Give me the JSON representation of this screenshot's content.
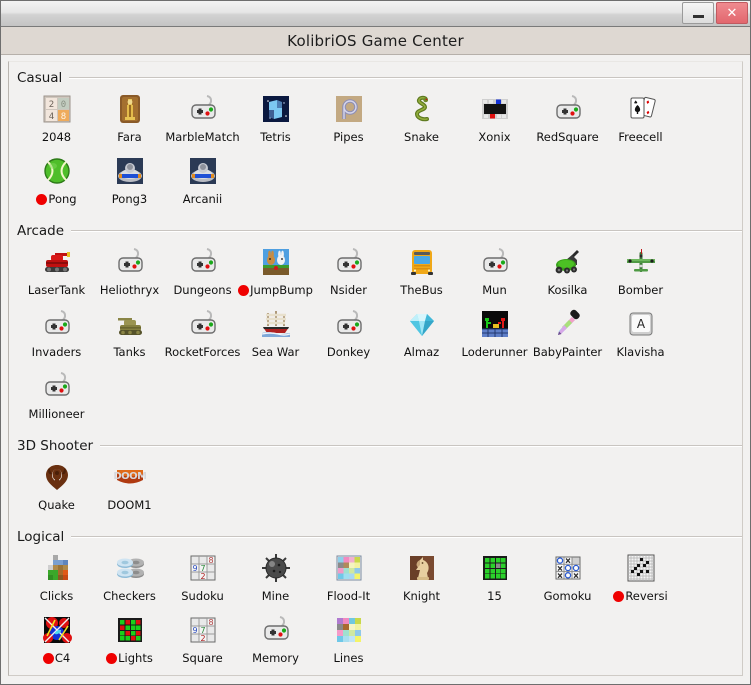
{
  "window": {
    "title": "KolibriOS Game Center",
    "minimize_label": "–",
    "close_label": "✕",
    "accent_red": "#ef0000",
    "close_button_color": "#e2676e",
    "caption_bg": "#ded8d2",
    "content_bg": "#f2f1f0"
  },
  "sections": [
    {
      "title": "Casual",
      "items": [
        {
          "label": "2048",
          "icon": "2048-icon",
          "flagged": false
        },
        {
          "label": "Fara",
          "icon": "fara-icon",
          "flagged": false
        },
        {
          "label": "MarbleMatch",
          "icon": "gamepad-icon",
          "flagged": false
        },
        {
          "label": "Tetris",
          "icon": "tetris-icon",
          "flagged": false
        },
        {
          "label": "Pipes",
          "icon": "pipes-icon",
          "flagged": false
        },
        {
          "label": "Snake",
          "icon": "snake-icon",
          "flagged": false
        },
        {
          "label": "Xonix",
          "icon": "xonix-icon",
          "flagged": false
        },
        {
          "label": "RedSquare",
          "icon": "gamepad-icon",
          "flagged": false
        },
        {
          "label": "Freecell",
          "icon": "cards-icon",
          "flagged": false
        },
        {
          "label": "Pong",
          "icon": "tennisball-icon",
          "flagged": true
        },
        {
          "label": "Pong3",
          "icon": "pong3-icon",
          "flagged": false
        },
        {
          "label": "Arcanii",
          "icon": "pong3-icon",
          "flagged": false
        }
      ]
    },
    {
      "title": "Arcade",
      "items": [
        {
          "label": "LaserTank",
          "icon": "redtank-icon",
          "flagged": false
        },
        {
          "label": "Heliothryx",
          "icon": "gamepad-icon",
          "flagged": false
        },
        {
          "label": "Dungeons",
          "icon": "gamepad-icon",
          "flagged": false
        },
        {
          "label": "JumpBump",
          "icon": "jumpbump-icon",
          "flagged": true
        },
        {
          "label": "Nsider",
          "icon": "gamepad-icon",
          "flagged": false
        },
        {
          "label": "TheBus",
          "icon": "bus-icon",
          "flagged": false
        },
        {
          "label": "Mun",
          "icon": "gamepad-icon",
          "flagged": false
        },
        {
          "label": "Kosilka",
          "icon": "mower-icon",
          "flagged": false
        },
        {
          "label": "Bomber",
          "icon": "plane-icon",
          "flagged": false
        },
        {
          "label": "Invaders",
          "icon": "gamepad-icon",
          "flagged": false
        },
        {
          "label": "Tanks",
          "icon": "khakitank-icon",
          "flagged": false
        },
        {
          "label": "RocketForces",
          "icon": "gamepad-icon",
          "flagged": false
        },
        {
          "label": "Sea War",
          "icon": "ship-icon",
          "flagged": false
        },
        {
          "label": "Donkey",
          "icon": "gamepad-icon",
          "flagged": false
        },
        {
          "label": "Almaz",
          "icon": "diamond-icon",
          "flagged": false
        },
        {
          "label": "Loderunner",
          "icon": "loderunner-icon",
          "flagged": false
        },
        {
          "label": "BabyPainter",
          "icon": "dropper-icon",
          "flagged": false
        },
        {
          "label": "Klavisha",
          "icon": "keycap-a-icon",
          "flagged": false
        },
        {
          "label": "Millioneer",
          "icon": "gamepad-icon",
          "flagged": false
        }
      ]
    },
    {
      "title": "3D Shooter",
      "items": [
        {
          "label": "Quake",
          "icon": "quake-icon",
          "flagged": false
        },
        {
          "label": "DOOM1",
          "icon": "doom-icon",
          "flagged": false
        }
      ]
    },
    {
      "title": "Logical",
      "items": [
        {
          "label": "Clicks",
          "icon": "clicks-icon",
          "flagged": false
        },
        {
          "label": "Checkers",
          "icon": "checkers-icon",
          "flagged": false
        },
        {
          "label": "Sudoku",
          "icon": "sudoku-icon",
          "flagged": false
        },
        {
          "label": "Mine",
          "icon": "mine-icon",
          "flagged": false
        },
        {
          "label": "Flood-It",
          "icon": "floodit-icon",
          "flagged": false
        },
        {
          "label": "Knight",
          "icon": "knight-icon",
          "flagged": false
        },
        {
          "label": "15",
          "icon": "fifteen-icon",
          "flagged": false
        },
        {
          "label": "Gomoku",
          "icon": "gomoku-icon",
          "flagged": false
        },
        {
          "label": "Reversi",
          "icon": "reversi-icon",
          "flagged": true
        },
        {
          "label": "C4",
          "icon": "c4-icon",
          "flagged": true
        },
        {
          "label": "Lights",
          "icon": "lights-icon",
          "flagged": true
        },
        {
          "label": "Square",
          "icon": "sudoku-icon",
          "flagged": false
        },
        {
          "label": "Memory",
          "icon": "gamepad-icon",
          "flagged": false
        },
        {
          "label": "Lines",
          "icon": "lines-icon",
          "flagged": false
        }
      ]
    }
  ]
}
